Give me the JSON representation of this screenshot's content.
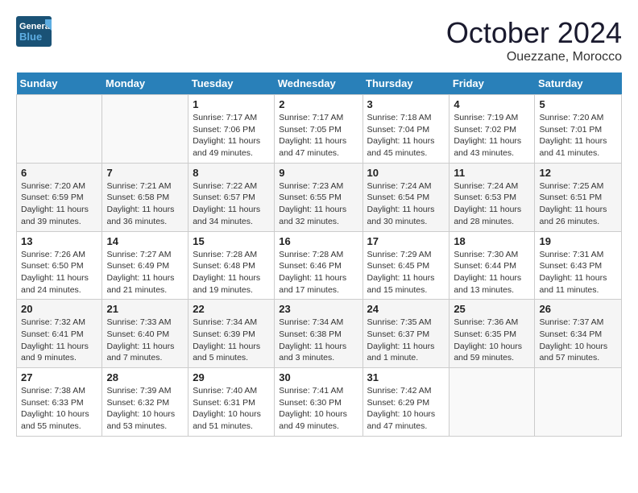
{
  "header": {
    "logo_general": "General",
    "logo_blue": "Blue",
    "month": "October 2024",
    "location": "Ouezzane, Morocco"
  },
  "weekdays": [
    "Sunday",
    "Monday",
    "Tuesday",
    "Wednesday",
    "Thursday",
    "Friday",
    "Saturday"
  ],
  "weeks": [
    [
      {
        "day": "",
        "info": ""
      },
      {
        "day": "",
        "info": ""
      },
      {
        "day": "1",
        "info": "Sunrise: 7:17 AM\nSunset: 7:06 PM\nDaylight: 11 hours and 49 minutes."
      },
      {
        "day": "2",
        "info": "Sunrise: 7:17 AM\nSunset: 7:05 PM\nDaylight: 11 hours and 47 minutes."
      },
      {
        "day": "3",
        "info": "Sunrise: 7:18 AM\nSunset: 7:04 PM\nDaylight: 11 hours and 45 minutes."
      },
      {
        "day": "4",
        "info": "Sunrise: 7:19 AM\nSunset: 7:02 PM\nDaylight: 11 hours and 43 minutes."
      },
      {
        "day": "5",
        "info": "Sunrise: 7:20 AM\nSunset: 7:01 PM\nDaylight: 11 hours and 41 minutes."
      }
    ],
    [
      {
        "day": "6",
        "info": "Sunrise: 7:20 AM\nSunset: 6:59 PM\nDaylight: 11 hours and 39 minutes."
      },
      {
        "day": "7",
        "info": "Sunrise: 7:21 AM\nSunset: 6:58 PM\nDaylight: 11 hours and 36 minutes."
      },
      {
        "day": "8",
        "info": "Sunrise: 7:22 AM\nSunset: 6:57 PM\nDaylight: 11 hours and 34 minutes."
      },
      {
        "day": "9",
        "info": "Sunrise: 7:23 AM\nSunset: 6:55 PM\nDaylight: 11 hours and 32 minutes."
      },
      {
        "day": "10",
        "info": "Sunrise: 7:24 AM\nSunset: 6:54 PM\nDaylight: 11 hours and 30 minutes."
      },
      {
        "day": "11",
        "info": "Sunrise: 7:24 AM\nSunset: 6:53 PM\nDaylight: 11 hours and 28 minutes."
      },
      {
        "day": "12",
        "info": "Sunrise: 7:25 AM\nSunset: 6:51 PM\nDaylight: 11 hours and 26 minutes."
      }
    ],
    [
      {
        "day": "13",
        "info": "Sunrise: 7:26 AM\nSunset: 6:50 PM\nDaylight: 11 hours and 24 minutes."
      },
      {
        "day": "14",
        "info": "Sunrise: 7:27 AM\nSunset: 6:49 PM\nDaylight: 11 hours and 21 minutes."
      },
      {
        "day": "15",
        "info": "Sunrise: 7:28 AM\nSunset: 6:48 PM\nDaylight: 11 hours and 19 minutes."
      },
      {
        "day": "16",
        "info": "Sunrise: 7:28 AM\nSunset: 6:46 PM\nDaylight: 11 hours and 17 minutes."
      },
      {
        "day": "17",
        "info": "Sunrise: 7:29 AM\nSunset: 6:45 PM\nDaylight: 11 hours and 15 minutes."
      },
      {
        "day": "18",
        "info": "Sunrise: 7:30 AM\nSunset: 6:44 PM\nDaylight: 11 hours and 13 minutes."
      },
      {
        "day": "19",
        "info": "Sunrise: 7:31 AM\nSunset: 6:43 PM\nDaylight: 11 hours and 11 minutes."
      }
    ],
    [
      {
        "day": "20",
        "info": "Sunrise: 7:32 AM\nSunset: 6:41 PM\nDaylight: 11 hours and 9 minutes."
      },
      {
        "day": "21",
        "info": "Sunrise: 7:33 AM\nSunset: 6:40 PM\nDaylight: 11 hours and 7 minutes."
      },
      {
        "day": "22",
        "info": "Sunrise: 7:34 AM\nSunset: 6:39 PM\nDaylight: 11 hours and 5 minutes."
      },
      {
        "day": "23",
        "info": "Sunrise: 7:34 AM\nSunset: 6:38 PM\nDaylight: 11 hours and 3 minutes."
      },
      {
        "day": "24",
        "info": "Sunrise: 7:35 AM\nSunset: 6:37 PM\nDaylight: 11 hours and 1 minute."
      },
      {
        "day": "25",
        "info": "Sunrise: 7:36 AM\nSunset: 6:35 PM\nDaylight: 10 hours and 59 minutes."
      },
      {
        "day": "26",
        "info": "Sunrise: 7:37 AM\nSunset: 6:34 PM\nDaylight: 10 hours and 57 minutes."
      }
    ],
    [
      {
        "day": "27",
        "info": "Sunrise: 7:38 AM\nSunset: 6:33 PM\nDaylight: 10 hours and 55 minutes."
      },
      {
        "day": "28",
        "info": "Sunrise: 7:39 AM\nSunset: 6:32 PM\nDaylight: 10 hours and 53 minutes."
      },
      {
        "day": "29",
        "info": "Sunrise: 7:40 AM\nSunset: 6:31 PM\nDaylight: 10 hours and 51 minutes."
      },
      {
        "day": "30",
        "info": "Sunrise: 7:41 AM\nSunset: 6:30 PM\nDaylight: 10 hours and 49 minutes."
      },
      {
        "day": "31",
        "info": "Sunrise: 7:42 AM\nSunset: 6:29 PM\nDaylight: 10 hours and 47 minutes."
      },
      {
        "day": "",
        "info": ""
      },
      {
        "day": "",
        "info": ""
      }
    ]
  ]
}
